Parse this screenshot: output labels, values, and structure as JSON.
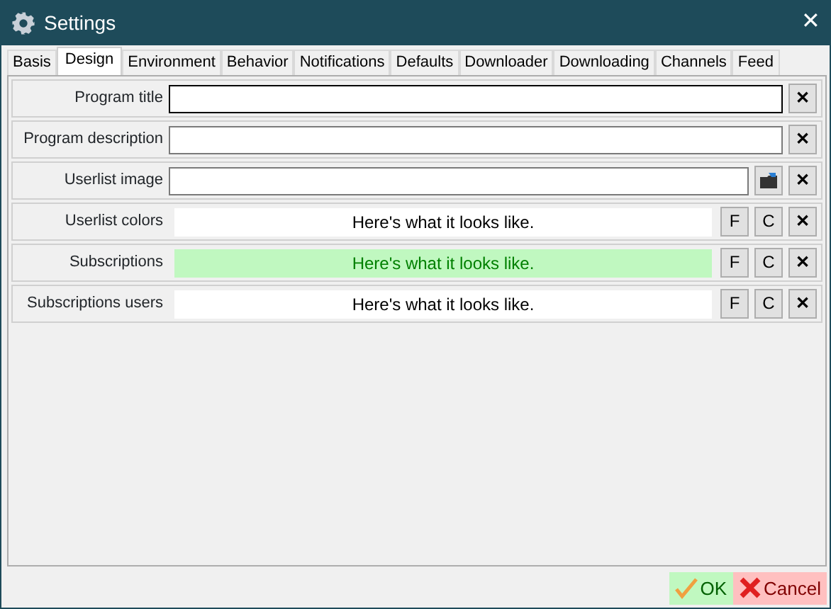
{
  "window": {
    "title": "Settings",
    "close": "✕"
  },
  "tabs": [
    {
      "label": "Basis",
      "selected": false
    },
    {
      "label": "Design",
      "selected": true
    },
    {
      "label": "Environment",
      "selected": false
    },
    {
      "label": "Behavior",
      "selected": false
    },
    {
      "label": "Notifications",
      "selected": false
    },
    {
      "label": "Defaults",
      "selected": false
    },
    {
      "label": "Downloader",
      "selected": false
    },
    {
      "label": "Downloading",
      "selected": false
    },
    {
      "label": "Channels",
      "selected": false
    },
    {
      "label": "Feed",
      "selected": false
    }
  ],
  "rows": [
    {
      "kind": "text",
      "label": "Program title",
      "focused": true,
      "clear": "✕"
    },
    {
      "kind": "text",
      "label": "Program description",
      "focused": false,
      "clear": "✕"
    },
    {
      "kind": "image",
      "label": "Userlist image",
      "focused": false,
      "clear": "✕"
    },
    {
      "kind": "color",
      "label": "Userlist colors",
      "preview": "Here's what it looks like.",
      "color": "#ffffff",
      "highlighted": false,
      "font_button": "F",
      "color_button": "C",
      "clear": "✕"
    },
    {
      "kind": "color",
      "label": "Subscriptions",
      "preview": "Here's what it looks like.",
      "color": "#c0f8c0",
      "highlighted": true,
      "font_button": "F",
      "color_button": "C",
      "clear": "✕"
    },
    {
      "kind": "color",
      "label": "Subscriptions users",
      "preview": "Here's what it looks like.",
      "color": "#ffffff",
      "highlighted": false,
      "font_button": "F",
      "color_button": "C",
      "clear": "✕"
    }
  ],
  "buttons": [
    {
      "kind": "ok",
      "label": "OK"
    },
    {
      "kind": "cancel",
      "label": "Cancel"
    }
  ]
}
